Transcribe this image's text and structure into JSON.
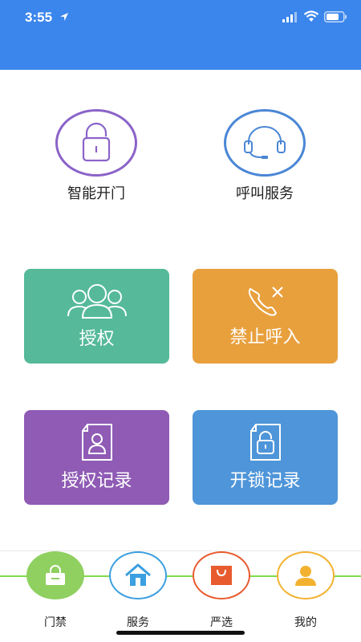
{
  "status_bar": {
    "time": "3:55"
  },
  "top_actions": [
    {
      "label": "智能开门",
      "icon": "unlock-icon",
      "color": "#8b63c9"
    },
    {
      "label": "呼叫服务",
      "icon": "headset-icon",
      "color": "#4a86d6"
    }
  ],
  "tiles": [
    {
      "label": "授权",
      "icon": "users-icon",
      "color": "#55b99a"
    },
    {
      "label": "禁止呼入",
      "icon": "call-block-icon",
      "color": "#e8a03d"
    },
    {
      "label": "授权记录",
      "icon": "user-document-icon",
      "color": "#8f5bb5"
    },
    {
      "label": "开锁记录",
      "icon": "lock-document-icon",
      "color": "#4e95d9"
    }
  ],
  "bottom_nav": [
    {
      "label": "门禁",
      "icon": "access-icon",
      "color": "#8fd060"
    },
    {
      "label": "服务",
      "icon": "home-icon",
      "color": "#3b9fe0"
    },
    {
      "label": "严选",
      "icon": "shopping-bag-icon",
      "color": "#e85b2f"
    },
    {
      "label": "我的",
      "icon": "person-icon",
      "color": "#f2b230"
    }
  ]
}
